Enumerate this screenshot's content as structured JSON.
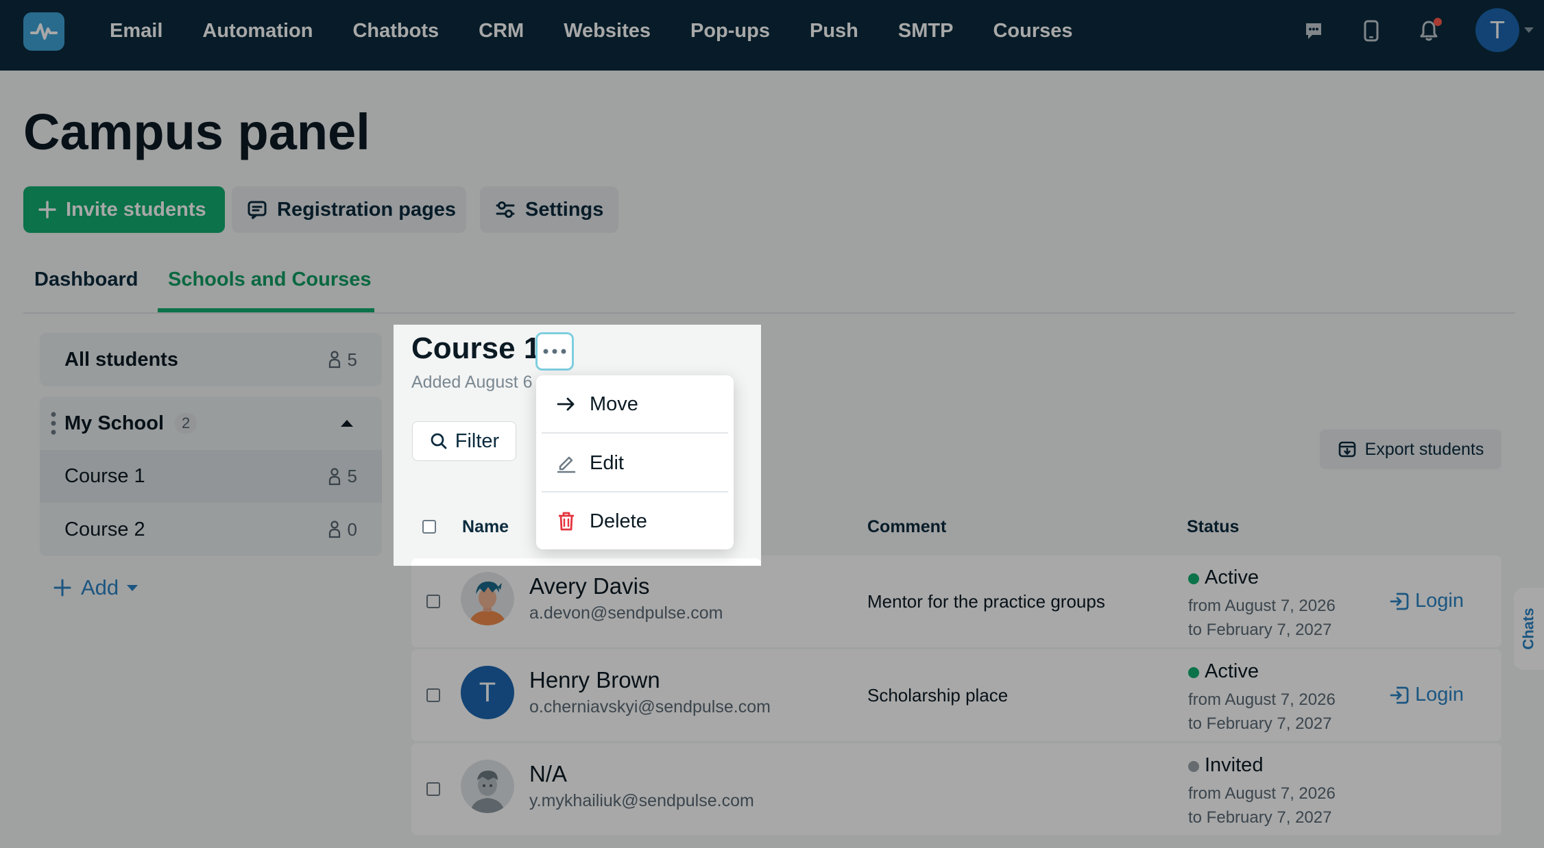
{
  "nav": {
    "items": [
      "Email",
      "Automation",
      "Chatbots",
      "CRM",
      "Websites",
      "Pop-ups",
      "Push",
      "SMTP",
      "Courses"
    ],
    "user_initial": "T"
  },
  "page": {
    "title": "Campus panel",
    "buttons": {
      "invite": "Invite students",
      "registration": "Registration pages",
      "settings": "Settings"
    },
    "tabs": [
      "Dashboard",
      "Schools and Courses"
    ]
  },
  "sidebar": {
    "all_students": {
      "label": "All students",
      "count": "5"
    },
    "school": {
      "label": "My School",
      "badge": "2"
    },
    "courses": [
      {
        "label": "Course 1",
        "count": "5"
      },
      {
        "label": "Course 2",
        "count": "0"
      }
    ],
    "add_label": "Add"
  },
  "course": {
    "title": "Course 1",
    "added": "Added August 6",
    "filter_label": "Filter",
    "export_label": "Export students"
  },
  "menu": {
    "items": [
      "Move",
      "Edit",
      "Delete"
    ]
  },
  "table": {
    "headers": {
      "name": "Name",
      "comment": "Comment",
      "status": "Status"
    },
    "rows": [
      {
        "name": "Avery Davis",
        "email": "a.devon@sendpulse.com",
        "comment": "Mentor for the practice groups",
        "status": "Active",
        "from": "from August 7, 2026",
        "to": "to February 7, 2027",
        "action": "Login",
        "status_color": "#11ae6f"
      },
      {
        "name": "Henry Brown",
        "email": "o.cherniavskyi@sendpulse.com",
        "comment": "Scholarship place",
        "status": "Active",
        "from": "from August 7, 2026",
        "to": "to February 7, 2027",
        "action": "Login",
        "avatar_initial": "T",
        "status_color": "#11ae6f"
      },
      {
        "name": "N/A",
        "email": "y.mykhailiuk@sendpulse.com",
        "comment": "",
        "status": "Invited",
        "from": "from August 7, 2026",
        "to": "to February 7, 2027",
        "status_color": "#9aa3a8"
      }
    ]
  },
  "chats_label": "Chats",
  "colors": {
    "brand_green": "#11ae6f",
    "nav_bg": "#0b2b3e",
    "link_blue": "#2a83c4",
    "delete_red": "#e3343f"
  }
}
